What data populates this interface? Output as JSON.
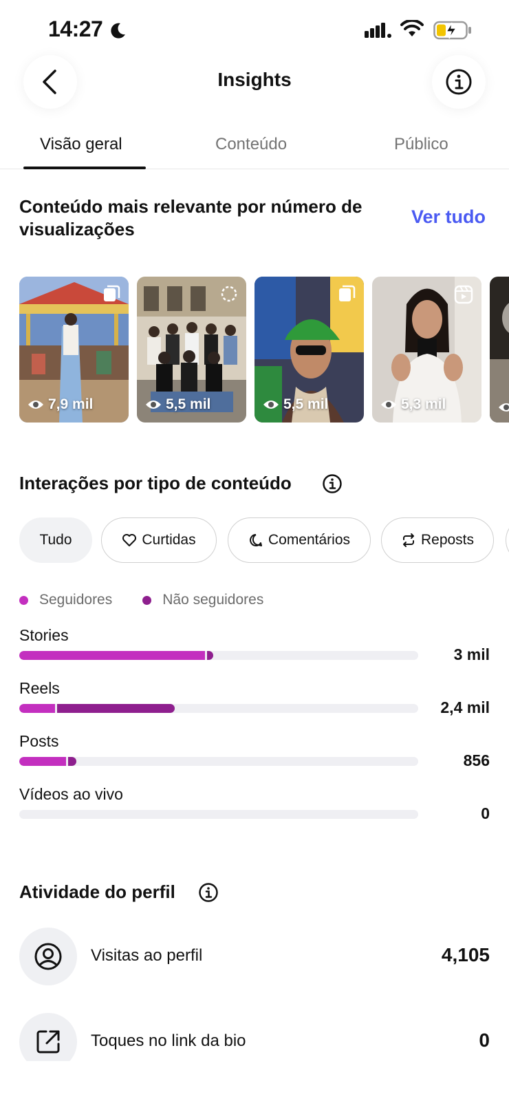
{
  "status_bar": {
    "time": "14:27"
  },
  "header": {
    "title": "Insights"
  },
  "tabs": [
    {
      "label": "Visão geral",
      "active": true
    },
    {
      "label": "Conteúdo",
      "active": false
    },
    {
      "label": "Público",
      "active": false
    }
  ],
  "top_content": {
    "title": "Conteúdo mais relevante por número de visualizações",
    "see_all": "Ver tudo",
    "items": [
      {
        "views": "7,9 mil",
        "type": "carousel-icon"
      },
      {
        "views": "5,5 mil",
        "type": "story-icon"
      },
      {
        "views": "5,5 mil",
        "type": "carousel-icon"
      },
      {
        "views": "5,3 mil",
        "type": "reel-icon"
      }
    ]
  },
  "interactions": {
    "title": "Interações por tipo de conteúdo",
    "filters": [
      {
        "label": "Tudo",
        "icon": "",
        "selected": true
      },
      {
        "label": "Curtidas",
        "icon": "heart-icon",
        "selected": false
      },
      {
        "label": "Comentários",
        "icon": "comment-icon",
        "selected": false
      },
      {
        "label": "Reposts",
        "icon": "repost-icon",
        "selected": false
      }
    ],
    "legend": [
      {
        "label": "Seguidores",
        "color": "#c32fbf"
      },
      {
        "label": "Não seguidores",
        "color": "#8e1f8e"
      }
    ],
    "rows": [
      {
        "label": "Stories",
        "value": "3 mil",
        "followers_fraction": 0.465,
        "non_followers_fraction": 0.015
      },
      {
        "label": "Reels",
        "value": "2,4 mil",
        "followers_fraction": 0.09,
        "non_followers_fraction": 0.295
      },
      {
        "label": "Posts",
        "value": "856",
        "followers_fraction": 0.118,
        "non_followers_fraction": 0.02
      },
      {
        "label": "Vídeos ao vivo",
        "value": "0",
        "followers_fraction": 0,
        "non_followers_fraction": 0
      }
    ]
  },
  "profile_activity": {
    "title": "Atividade do perfil",
    "items": [
      {
        "label": "Visitas ao perfil",
        "value": "4,105",
        "icon": "profile-icon"
      },
      {
        "label": "Toques no link da bio",
        "value": "0",
        "icon": "external-link-icon"
      }
    ]
  },
  "colors": {
    "accent_link": "#4a5af2",
    "followers": "#c32fbf",
    "non_followers": "#8e1f8e",
    "track": "#efeff3"
  }
}
